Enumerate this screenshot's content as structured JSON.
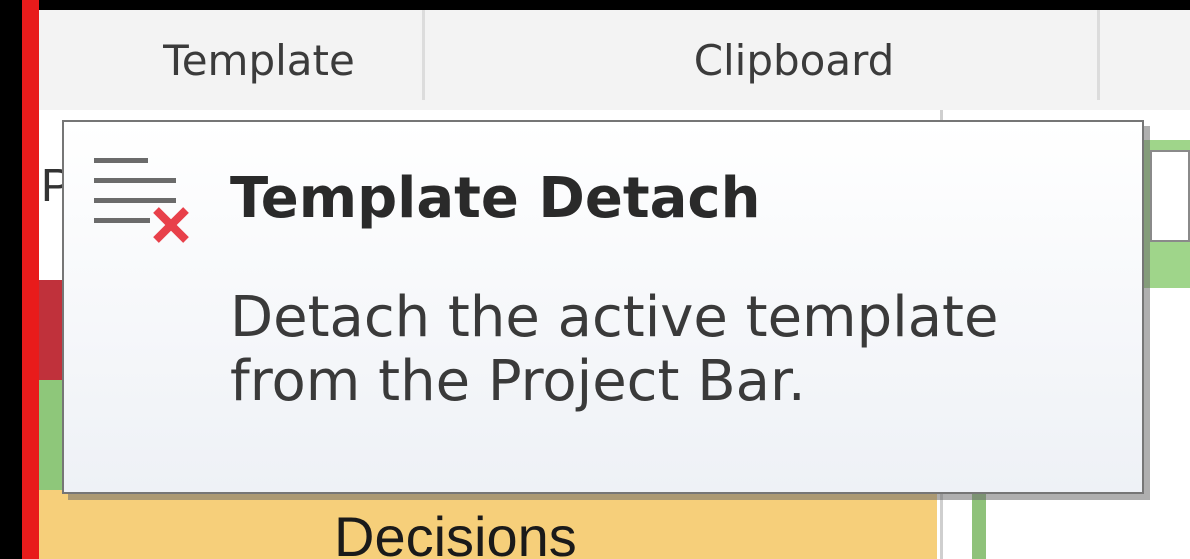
{
  "ribbon": {
    "groups": [
      {
        "label": "Template"
      },
      {
        "label": "Clipboard"
      }
    ]
  },
  "left_panel": {
    "header_letter": "P",
    "decisions_label": "Decisions"
  },
  "tooltip": {
    "icon": "template-detach-icon",
    "title": "Template Detach",
    "body_line1": "Detach the active template",
    "body_line2": "from the Project Bar."
  },
  "colors": {
    "accent_red": "#e81b1b",
    "band_red": "#c0313b",
    "band_green": "#8ec77a",
    "band_yellow": "#f6cf7a"
  }
}
